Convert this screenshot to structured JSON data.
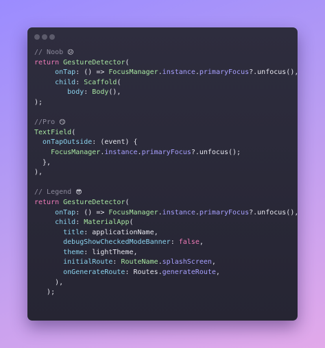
{
  "window": {
    "lines": [
      [
        {
          "t": "// Noob ",
          "c": "comment"
        },
        {
          "t": "😕",
          "c": "emoji"
        }
      ],
      [
        {
          "t": "return ",
          "c": "kw"
        },
        {
          "t": "GestureDetector",
          "c": "class"
        },
        {
          "t": "(",
          "c": "plain"
        }
      ],
      [
        {
          "t": "     onTap",
          "c": "param"
        },
        {
          "t": ": () => ",
          "c": "plain"
        },
        {
          "t": "FocusManager",
          "c": "class"
        },
        {
          "t": ".",
          "c": "plain"
        },
        {
          "t": "instance",
          "c": "prop"
        },
        {
          "t": ".",
          "c": "plain"
        },
        {
          "t": "primaryFocus",
          "c": "prop"
        },
        {
          "t": "?.unfocus(),",
          "c": "plain"
        }
      ],
      [
        {
          "t": "     child",
          "c": "param"
        },
        {
          "t": ": ",
          "c": "plain"
        },
        {
          "t": "Scaffold",
          "c": "class"
        },
        {
          "t": "(",
          "c": "plain"
        }
      ],
      [
        {
          "t": "        body",
          "c": "param"
        },
        {
          "t": ": ",
          "c": "plain"
        },
        {
          "t": "Body",
          "c": "class"
        },
        {
          "t": "(),",
          "c": "plain"
        }
      ],
      [
        {
          "t": ");",
          "c": "plain"
        }
      ],
      [
        {
          "t": "",
          "c": "plain"
        }
      ],
      [
        {
          "t": "//Pro ",
          "c": "comment"
        },
        {
          "t": "😏",
          "c": "emoji"
        }
      ],
      [
        {
          "t": "TextField",
          "c": "class"
        },
        {
          "t": "(",
          "c": "plain"
        }
      ],
      [
        {
          "t": "  onTapOutside",
          "c": "param"
        },
        {
          "t": ": (event) {",
          "c": "plain"
        }
      ],
      [
        {
          "t": "    FocusManager",
          "c": "class"
        },
        {
          "t": ".",
          "c": "plain"
        },
        {
          "t": "instance",
          "c": "prop"
        },
        {
          "t": ".",
          "c": "plain"
        },
        {
          "t": "primaryFocus",
          "c": "prop"
        },
        {
          "t": "?.unfocus();",
          "c": "plain"
        }
      ],
      [
        {
          "t": "  },",
          "c": "plain"
        }
      ],
      [
        {
          "t": "),",
          "c": "plain"
        }
      ],
      [
        {
          "t": "",
          "c": "plain"
        }
      ],
      [
        {
          "t": "// Legend ",
          "c": "comment"
        },
        {
          "t": "😎",
          "c": "emoji"
        }
      ],
      [
        {
          "t": "return ",
          "c": "kw"
        },
        {
          "t": "GestureDetector",
          "c": "class"
        },
        {
          "t": "(",
          "c": "plain"
        }
      ],
      [
        {
          "t": "     onTap",
          "c": "param"
        },
        {
          "t": ": () => ",
          "c": "plain"
        },
        {
          "t": "FocusManager",
          "c": "class"
        },
        {
          "t": ".",
          "c": "plain"
        },
        {
          "t": "instance",
          "c": "prop"
        },
        {
          "t": ".",
          "c": "plain"
        },
        {
          "t": "primaryFocus",
          "c": "prop"
        },
        {
          "t": "?.unfocus(),",
          "c": "plain"
        }
      ],
      [
        {
          "t": "     child",
          "c": "param"
        },
        {
          "t": ": ",
          "c": "plain"
        },
        {
          "t": "MaterialApp",
          "c": "class"
        },
        {
          "t": "(",
          "c": "plain"
        }
      ],
      [
        {
          "t": "       title",
          "c": "param"
        },
        {
          "t": ": applicationName,",
          "c": "plain"
        }
      ],
      [
        {
          "t": "       debugShowCheckedModeBanner",
          "c": "param"
        },
        {
          "t": ": ",
          "c": "plain"
        },
        {
          "t": "false",
          "c": "kw"
        },
        {
          "t": ",",
          "c": "plain"
        }
      ],
      [
        {
          "t": "       theme",
          "c": "param"
        },
        {
          "t": ": lightTheme,",
          "c": "plain"
        }
      ],
      [
        {
          "t": "       initialRoute",
          "c": "param"
        },
        {
          "t": ": ",
          "c": "plain"
        },
        {
          "t": "RouteName",
          "c": "class"
        },
        {
          "t": ".",
          "c": "plain"
        },
        {
          "t": "splashScreen",
          "c": "prop"
        },
        {
          "t": ",",
          "c": "plain"
        }
      ],
      [
        {
          "t": "       onGenerateRoute",
          "c": "param"
        },
        {
          "t": ": Routes.",
          "c": "plain"
        },
        {
          "t": "generateRoute",
          "c": "prop"
        },
        {
          "t": ",",
          "c": "plain"
        }
      ],
      [
        {
          "t": "     ),",
          "c": "plain"
        }
      ],
      [
        {
          "t": "   );",
          "c": "plain"
        }
      ]
    ]
  },
  "colors": {
    "comment": "#8d8b9d",
    "keyword": "#f07ab8",
    "class": "#a8e6a1",
    "param": "#8bd3ee",
    "property": "#a8a0ff",
    "plain": "#e6e6ee"
  }
}
